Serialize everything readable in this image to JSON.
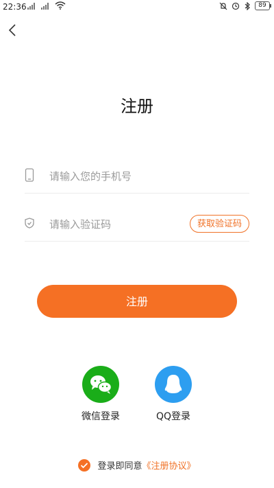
{
  "status_bar": {
    "time": "22:36",
    "battery": "89"
  },
  "page": {
    "title": "注册"
  },
  "phone_field": {
    "placeholder": "请输入您的手机号"
  },
  "code_field": {
    "placeholder": "请输入验证码",
    "button_label": "获取验证码"
  },
  "register_button": {
    "label": "注册"
  },
  "social_login": {
    "wechat_label": "微信登录",
    "qq_label": "QQ登录"
  },
  "agreement": {
    "text": "登录即同意",
    "link": "《注册协议》"
  },
  "colors": {
    "accent": "#f57024",
    "wechat": "#1aad19",
    "qq": "#2d9ef0"
  }
}
